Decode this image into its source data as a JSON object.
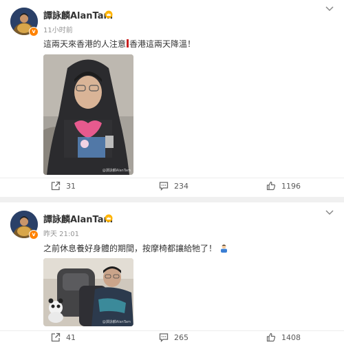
{
  "posts": [
    {
      "author": "譚詠麟AlanTam",
      "time": "11小时前",
      "text_part1": "這兩天來香港的人注意",
      "text_part2": "香港這兩天降溫！",
      "watermark": "@譚詠麟AlanTam",
      "reposts": "31",
      "comments": "234",
      "likes": "1196",
      "icons": {
        "verified": "orange-v-badge",
        "crown": "crown-icon",
        "more": "chevron-down-icon"
      }
    },
    {
      "author": "譚詠麟AlanTam",
      "time": "昨天 21:01",
      "text": "之前休息養好身體的期間，按摩椅都讓給牠了！",
      "watermark": "@譚詠麟AlanTam",
      "reposts": "41",
      "comments": "265",
      "likes": "1408",
      "icons": {
        "verified": "orange-v-badge",
        "crown": "crown-icon",
        "more": "chevron-down-icon",
        "emoji": "person-emoji"
      }
    }
  ],
  "colors": {
    "accent": "#ff8200",
    "text": "#333333",
    "meta": "#939393",
    "background": "#f0f0f0"
  }
}
